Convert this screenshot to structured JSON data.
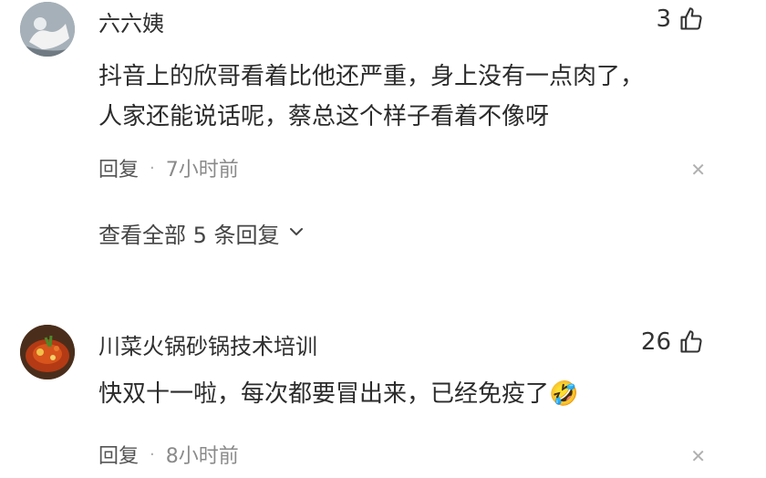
{
  "comments": [
    {
      "username": "六六姨",
      "like_count": "3",
      "text_line1": "抖音上的欣哥看着比他还严重，身上没有一点肉了，",
      "text_line2": "人家还能说话呢，蔡总这个样子看着不像呀",
      "reply_label": "回复",
      "separator": "·",
      "time": "7小时前",
      "view_replies": "查看全部 5 条回复"
    },
    {
      "username": "川菜火锅砂锅技术培训",
      "like_count": "26",
      "text": "快双十一啦，每次都要冒出来，已经免疫了",
      "emoji": "🤣",
      "reply_label": "回复",
      "separator": "·",
      "time": "8小时前"
    }
  ]
}
